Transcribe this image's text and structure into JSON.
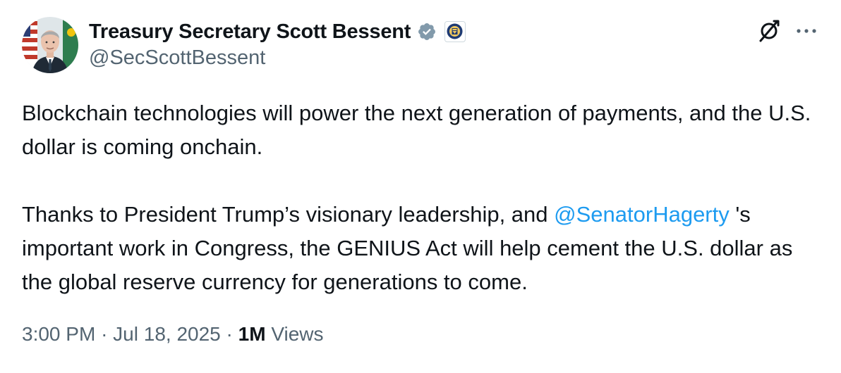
{
  "author": {
    "display_name": "Treasury Secretary Scott Bessent",
    "handle": "@SecScottBessent",
    "verified_badge_icon": "verified-badge-icon",
    "affiliate_badge_icon": "treasury-seal-icon",
    "verified_color": "#829aab"
  },
  "header_actions": {
    "grok_icon": "grok-icon",
    "more_icon": "more-options-icon"
  },
  "tweet": {
    "paragraph1": "Blockchain technologies will power the next generation of payments, and the U.S. dollar is coming onchain.",
    "paragraph2_before": "Thanks to President Trump’s visionary leadership, and ",
    "mention": "@SenatorHagerty",
    "paragraph2_after": " 's important work in Congress, the GENIUS Act will help cement the U.S. dollar as the global reserve currency for generations to come."
  },
  "meta": {
    "time": "3:00 PM",
    "separator": "·",
    "date": "Jul 18, 2025",
    "views_count": "1M",
    "views_label": "Views"
  },
  "colors": {
    "text": "#0f1419",
    "secondary": "#536471",
    "link": "#1d9bf0"
  }
}
